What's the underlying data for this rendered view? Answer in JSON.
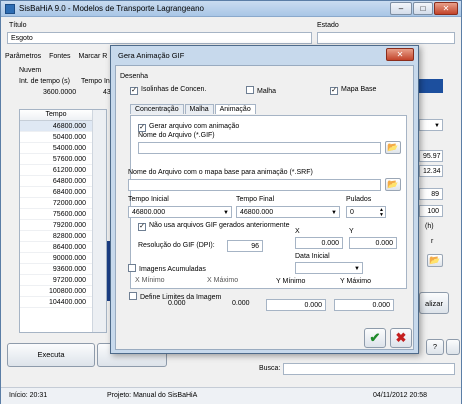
{
  "window": {
    "title": "SisBaHiA 9.0 - Modelos de Transporte Lagrangeano",
    "min": "–",
    "max": "□",
    "close": "✕"
  },
  "main": {
    "titulo_label": "Título",
    "estado_label": "Estado",
    "titulo_value": "Esgoto",
    "tabs": [
      "Parâmetros",
      "Fontes",
      "Marcar R"
    ],
    "nuvem_label": "Nuvem",
    "int_tempo_label": "Int. de tempo (s)",
    "tempo_ini_label": "Tempo Ini",
    "int_tempo_value": "3600.0000",
    "tempo_ini_value": "43",
    "table_header": "Tempo",
    "tempos": [
      "46800.000",
      "50400.000",
      "54000.000",
      "57600.000",
      "61200.000",
      "64800.000",
      "68400.000",
      "72000.000",
      "75600.000",
      "79200.000",
      "82800.000",
      "86400.000",
      "90000.000",
      "93600.000",
      "97200.000",
      "100800.000",
      "104400.000"
    ],
    "right_values": [
      "95.97",
      "12.34",
      "89",
      "100"
    ],
    "right_label_h": "(h)",
    "right_label_r": "r",
    "atualiza_label": "alizar",
    "executa_label": "Executa",
    "help_label": "?",
    "busca_label": "Busca:",
    "status_inicio": "Início: 20:31",
    "status_projeto": "Projeto: Manual do SisBaHiA",
    "status_data": "04/11/2012 20:58"
  },
  "dialog": {
    "title": "Gera Animação GIF",
    "close": "✕",
    "desenha_label": "Desenha",
    "isolinhas_label": "Isolinhas de Concen.",
    "isolinhas_checked": true,
    "malha_label": "Malha",
    "malha_checked": false,
    "mapa_base_label": "Mapa Base",
    "mapa_base_checked": true,
    "tabs": [
      "Concentração",
      "Malha",
      "Animação"
    ],
    "gerar_label": "Gerar arquivo com animação",
    "gerar_checked": true,
    "nome_arquivo_label": "Nome do Arquivo (*.GIF)",
    "nome_arquivo_value": "",
    "nome_mapa_label": "Nome do Arquivo com o mapa base para animação (*.SRF)",
    "nome_mapa_value": "",
    "tempo_inicial_label": "Tempo Inicial",
    "tempo_inicial_value": "46800.000",
    "tempo_final_label": "Tempo Final",
    "tempo_final_value": "46800.000",
    "pulados_label": "Pulados",
    "pulados_value": "0",
    "nao_usa_label": "Não usa arquivos GIF gerados anteriormente",
    "nao_usa_checked": true,
    "x_label": "X",
    "y_label": "Y",
    "x_value": "0.000",
    "y_value": "0.000",
    "resolucao_label": "Resolução do GIF (DPI):",
    "resolucao_value": "96",
    "data_inicial_label": "Data Inicial",
    "imagens_acumuladas_label": "Imagens Acumuladas",
    "imagens_acumuladas_checked": false,
    "x_minimo_label": "X Mínimo",
    "x_maximo_label": "X Máximo",
    "y_minimo_label": "Y Mínimo",
    "y_maximo_label": "Y Máximo",
    "define_limites_label": "Define Limites da Imagem",
    "define_limites_checked": false,
    "lim_values": [
      "0.000",
      "0.000",
      "0.000",
      "0.000"
    ],
    "ok_glyph": "✔",
    "cancel_glyph": "✖",
    "folder_glyph": "📂"
  }
}
